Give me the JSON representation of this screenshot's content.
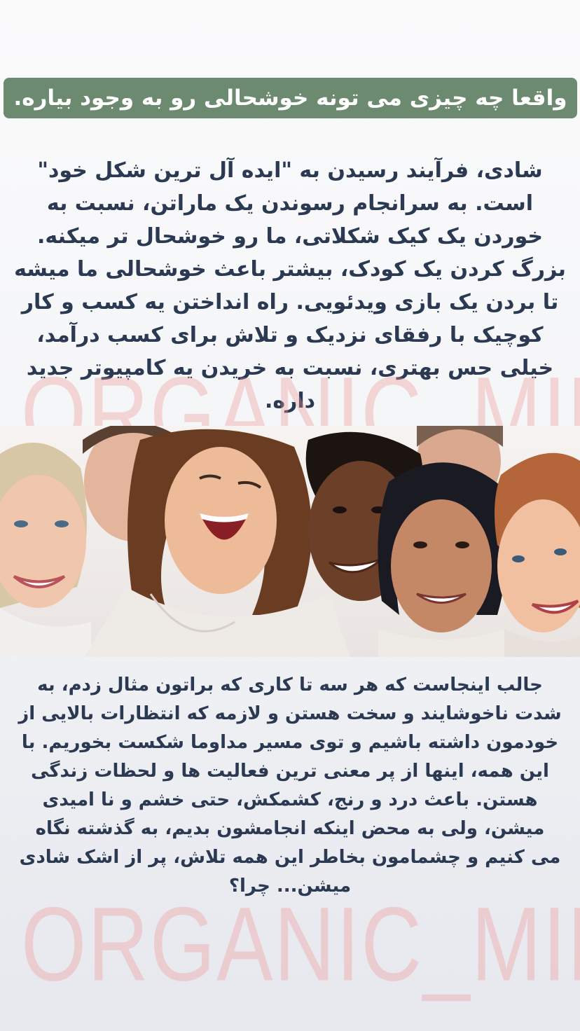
{
  "story": {
    "title": "واقعا چه چیزی می تونه خوشحالی رو به وجود بیاره.",
    "paragraph_1": "شادی، فرآیند رسیدن به \"ایده آل ترین شکل خود\" است. به سرانجام رسوندن یک ماراتن، نسبت به خوردن یک کیک شکلاتی، ما رو خوشحال تر میکنه. بزرگ کردن یک کودک، بیشتر باعث خوشحالی ما میشه تا بردن یک بازی ویدئویی. راه انداختن یه کسب و کار کوچیک با رفقای نزدیک و تلاش برای کسب درآمد، خیلی حس بهتری، نسبت به خریدن یه کامپیوتر جدید داره.",
    "paragraph_2": "جالب اینجاست که هر سه تا کاری که براتون مثال زدم، به شدت ناخوشایند و سخت هستن و لازمه که انتظارات بالایی از خودمون داشته باشیم و توی مسیر مداوما شکست بخوریم. با این همه، اینها از پر معنی ترین فعالیت ها و لحظات زندگی هستن. باعث درد و رنج، کشمکش، حتی خشم و نا امیدی میشن، ولی به محض اینکه انجامشون بدیم، به گذشته نگاه می کنیم و چشمامون بخاطر این همه تلاش، پر از اشک شادی میشن... چرا؟",
    "watermark": "ORGANIC_MINDED",
    "photo_description": "group-of-laughing-friends"
  },
  "colors": {
    "banner": "#6b8a70",
    "text": "#2b3a52",
    "watermark": "#f09696"
  }
}
